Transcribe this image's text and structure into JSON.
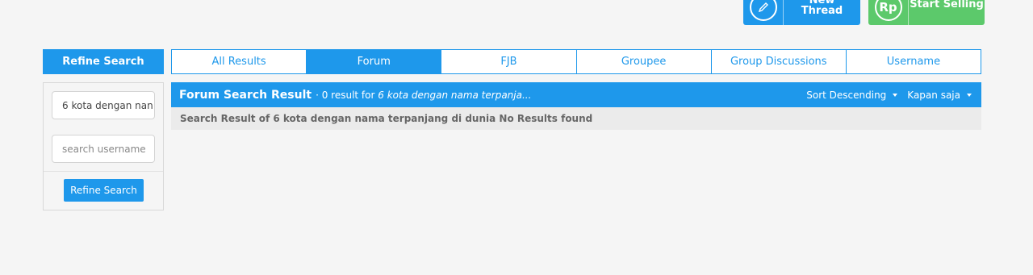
{
  "top_buttons": {
    "create": {
      "label": "Create New Thread",
      "icon": "pencil-icon"
    },
    "sell": {
      "label": "Start Selling",
      "icon_text": "Rp"
    }
  },
  "sidebar": {
    "header": "Refine Search",
    "query_value": "6 kota dengan nan",
    "username_placeholder": "search username",
    "button_label": "Refine Search"
  },
  "tabs": [
    {
      "label": "All Results",
      "active": false
    },
    {
      "label": "Forum",
      "active": true
    },
    {
      "label": "FJB",
      "active": false
    },
    {
      "label": "Groupee",
      "active": false
    },
    {
      "label": "Group Discussions",
      "active": false
    },
    {
      "label": "Username",
      "active": false
    }
  ],
  "results": {
    "title": "Forum Search Result",
    "meta_prefix": " · 0 result for ",
    "meta_query": "6 kota dengan nama terpanja...",
    "sort_label": "Sort Descending",
    "time_label": "Kapan saja",
    "message": "Search Result of 6 kota dengan nama terpanjang di dunia No Results found"
  },
  "colors": {
    "primary": "#1e98eb",
    "sell": "#5cc96b",
    "background": "#f5f5f5"
  }
}
